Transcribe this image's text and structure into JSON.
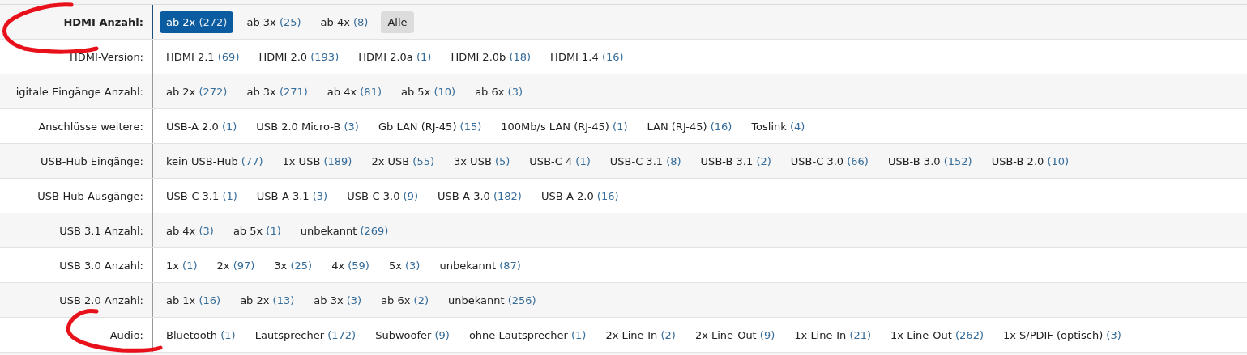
{
  "filters": [
    {
      "label": "HDMI Anzahl:",
      "active": true,
      "options": [
        {
          "kind": "option",
          "label": "ab 2x",
          "count": "(272)",
          "selected": true
        },
        {
          "kind": "option",
          "label": "ab 3x",
          "count": "(25)",
          "selected": false
        },
        {
          "kind": "option",
          "label": "ab 4x",
          "count": "(8)",
          "selected": false
        },
        {
          "kind": "reset",
          "label": "Alle",
          "selected": false
        }
      ]
    },
    {
      "label": "HDMI-Version:",
      "active": false,
      "options": [
        {
          "kind": "option",
          "label": "HDMI 2.1",
          "count": "(69)",
          "selected": false
        },
        {
          "kind": "option",
          "label": "HDMI 2.0",
          "count": "(193)",
          "selected": false
        },
        {
          "kind": "option",
          "label": "HDMI 2.0a",
          "count": "(1)",
          "selected": false
        },
        {
          "kind": "option",
          "label": "HDMI 2.0b",
          "count": "(18)",
          "selected": false
        },
        {
          "kind": "option",
          "label": "HDMI 1.4",
          "count": "(16)",
          "selected": false
        }
      ]
    },
    {
      "label": "igitale Eingänge Anzahl:",
      "active": false,
      "options": [
        {
          "kind": "option",
          "label": "ab 2x",
          "count": "(272)",
          "selected": false
        },
        {
          "kind": "option",
          "label": "ab 3x",
          "count": "(271)",
          "selected": false
        },
        {
          "kind": "option",
          "label": "ab 4x",
          "count": "(81)",
          "selected": false
        },
        {
          "kind": "option",
          "label": "ab 5x",
          "count": "(10)",
          "selected": false
        },
        {
          "kind": "option",
          "label": "ab 6x",
          "count": "(3)",
          "selected": false
        }
      ]
    },
    {
      "label": "Anschlüsse weitere:",
      "active": false,
      "options": [
        {
          "kind": "option",
          "label": "USB-A 2.0",
          "count": "(1)",
          "selected": false
        },
        {
          "kind": "option",
          "label": "USB 2.0 Micro-B",
          "count": "(3)",
          "selected": false
        },
        {
          "kind": "option",
          "label": "Gb LAN (RJ-45)",
          "count": "(15)",
          "selected": false
        },
        {
          "kind": "option",
          "label": "100Mb/s LAN (RJ-45)",
          "count": "(1)",
          "selected": false
        },
        {
          "kind": "option",
          "label": "LAN (RJ-45)",
          "count": "(16)",
          "selected": false
        },
        {
          "kind": "option",
          "label": "Toslink",
          "count": "(4)",
          "selected": false
        }
      ]
    },
    {
      "label": "USB-Hub Eingänge:",
      "active": false,
      "options": [
        {
          "kind": "option",
          "label": "kein USB-Hub",
          "count": "(77)",
          "selected": false
        },
        {
          "kind": "option",
          "label": "1x USB",
          "count": "(189)",
          "selected": false
        },
        {
          "kind": "option",
          "label": "2x USB",
          "count": "(55)",
          "selected": false
        },
        {
          "kind": "option",
          "label": "3x USB",
          "count": "(5)",
          "selected": false
        },
        {
          "kind": "option",
          "label": "USB-C 4",
          "count": "(1)",
          "selected": false
        },
        {
          "kind": "option",
          "label": "USB-C 3.1",
          "count": "(8)",
          "selected": false
        },
        {
          "kind": "option",
          "label": "USB-B 3.1",
          "count": "(2)",
          "selected": false
        },
        {
          "kind": "option",
          "label": "USB-C 3.0",
          "count": "(66)",
          "selected": false
        },
        {
          "kind": "option",
          "label": "USB-B 3.0",
          "count": "(152)",
          "selected": false
        },
        {
          "kind": "option",
          "label": "USB-B 2.0",
          "count": "(10)",
          "selected": false
        }
      ]
    },
    {
      "label": "USB-Hub Ausgänge:",
      "active": false,
      "options": [
        {
          "kind": "option",
          "label": "USB-C 3.1",
          "count": "(1)",
          "selected": false
        },
        {
          "kind": "option",
          "label": "USB-A 3.1",
          "count": "(3)",
          "selected": false
        },
        {
          "kind": "option",
          "label": "USB-C 3.0",
          "count": "(9)",
          "selected": false
        },
        {
          "kind": "option",
          "label": "USB-A 3.0",
          "count": "(182)",
          "selected": false
        },
        {
          "kind": "option",
          "label": "USB-A 2.0",
          "count": "(16)",
          "selected": false
        }
      ]
    },
    {
      "label": "USB 3.1 Anzahl:",
      "active": false,
      "options": [
        {
          "kind": "option",
          "label": "ab 4x",
          "count": "(3)",
          "selected": false
        },
        {
          "kind": "option",
          "label": "ab 5x",
          "count": "(1)",
          "selected": false
        },
        {
          "kind": "option",
          "label": "unbekannt",
          "count": "(269)",
          "selected": false
        }
      ]
    },
    {
      "label": "USB 3.0 Anzahl:",
      "active": false,
      "options": [
        {
          "kind": "option",
          "label": "1x",
          "count": "(1)",
          "selected": false
        },
        {
          "kind": "option",
          "label": "2x",
          "count": "(97)",
          "selected": false
        },
        {
          "kind": "option",
          "label": "3x",
          "count": "(25)",
          "selected": false
        },
        {
          "kind": "option",
          "label": "4x",
          "count": "(59)",
          "selected": false
        },
        {
          "kind": "option",
          "label": "5x",
          "count": "(3)",
          "selected": false
        },
        {
          "kind": "option",
          "label": "unbekannt",
          "count": "(87)",
          "selected": false
        }
      ]
    },
    {
      "label": "USB 2.0 Anzahl:",
      "active": false,
      "options": [
        {
          "kind": "option",
          "label": "ab 1x",
          "count": "(16)",
          "selected": false
        },
        {
          "kind": "option",
          "label": "ab 2x",
          "count": "(13)",
          "selected": false
        },
        {
          "kind": "option",
          "label": "ab 3x",
          "count": "(3)",
          "selected": false
        },
        {
          "kind": "option",
          "label": "ab 6x",
          "count": "(2)",
          "selected": false
        },
        {
          "kind": "option",
          "label": "unbekannt",
          "count": "(256)",
          "selected": false
        }
      ]
    },
    {
      "label": "Audio:",
      "active": false,
      "options": [
        {
          "kind": "option",
          "label": "Bluetooth",
          "count": "(1)",
          "selected": false
        },
        {
          "kind": "option",
          "label": "Lautsprecher",
          "count": "(172)",
          "selected": false
        },
        {
          "kind": "option",
          "label": "Subwoofer",
          "count": "(9)",
          "selected": false
        },
        {
          "kind": "option",
          "label": "ohne Lautsprecher",
          "count": "(1)",
          "selected": false
        },
        {
          "kind": "option",
          "label": "2x Line-In",
          "count": "(2)",
          "selected": false
        },
        {
          "kind": "option",
          "label": "2x Line-Out",
          "count": "(9)",
          "selected": false
        },
        {
          "kind": "option",
          "label": "1x Line-In",
          "count": "(21)",
          "selected": false
        },
        {
          "kind": "option",
          "label": "1x Line-Out",
          "count": "(262)",
          "selected": false
        },
        {
          "kind": "option",
          "label": "1x S/PDIF (optisch)",
          "count": "(3)",
          "selected": false
        }
      ]
    }
  ]
}
